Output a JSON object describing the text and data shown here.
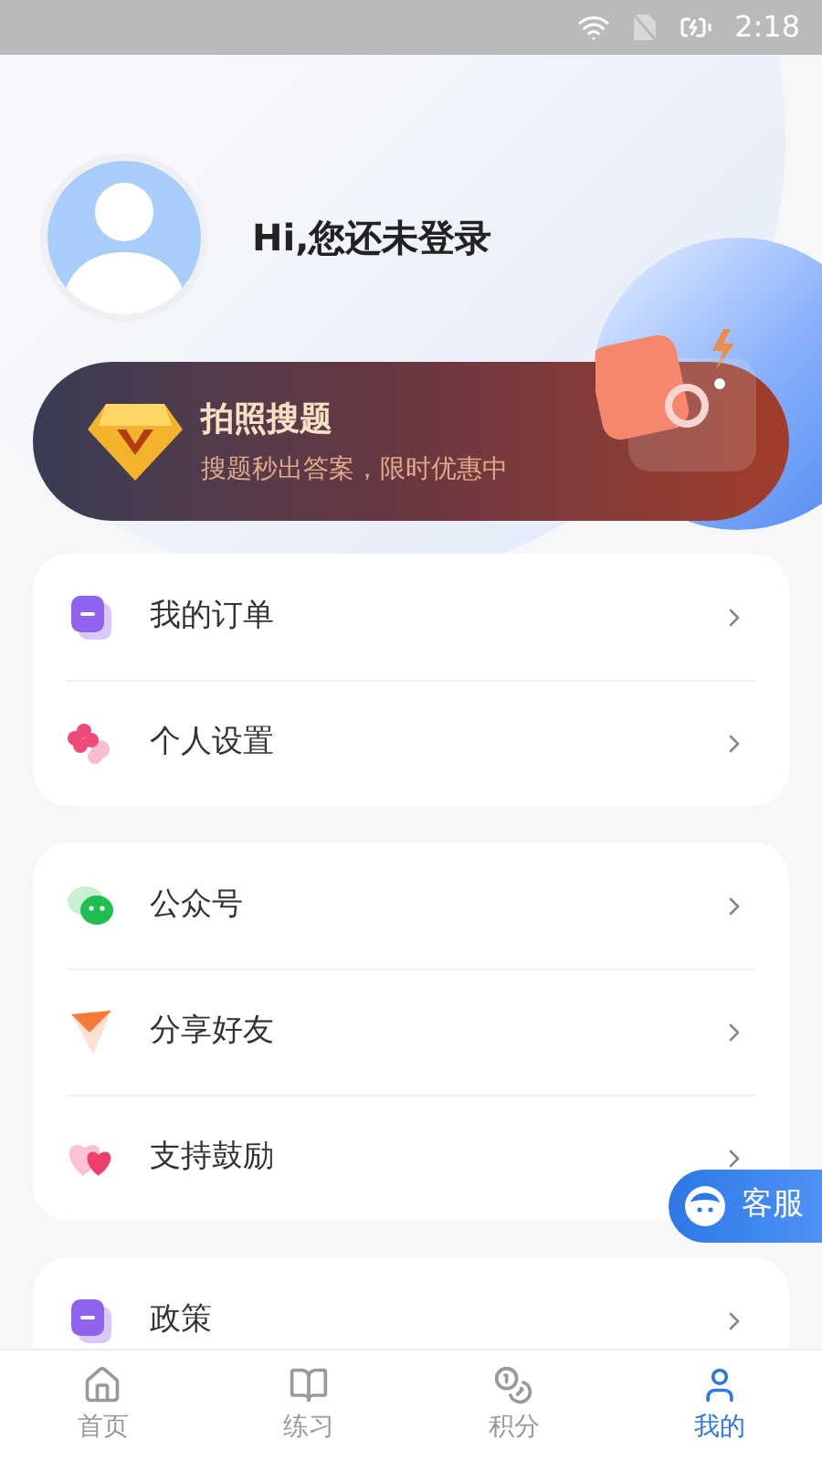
{
  "status_bar": {
    "time": "2:18"
  },
  "profile": {
    "greeting": "Hi,您还未登录"
  },
  "promo": {
    "title": "拍照搜题",
    "subtitle": "搜题秒出答案，限时优惠中"
  },
  "menu_groups": [
    {
      "items": [
        {
          "label": "我的订单",
          "kind": "order"
        },
        {
          "label": "个人设置",
          "kind": "settings"
        }
      ]
    },
    {
      "items": [
        {
          "label": "公众号",
          "kind": "wechat"
        },
        {
          "label": "分享好友",
          "kind": "share"
        },
        {
          "label": "支持鼓励",
          "kind": "heart"
        }
      ]
    },
    {
      "items": [
        {
          "label": "政策",
          "kind": "order"
        }
      ]
    }
  ],
  "support_button": {
    "label": "客服"
  },
  "bottom_nav": [
    {
      "label": "首页",
      "kind": "home",
      "selected": false
    },
    {
      "label": "练习",
      "kind": "practice",
      "selected": false
    },
    {
      "label": "积分",
      "kind": "points",
      "selected": false
    },
    {
      "label": "我的",
      "kind": "me",
      "selected": true
    }
  ]
}
